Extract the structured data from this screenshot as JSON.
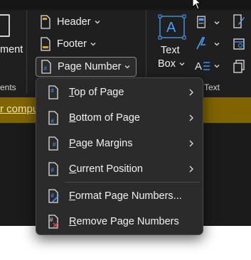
{
  "ribbon": {
    "left_cut_label": "ment",
    "left_group_label": "ents",
    "header_label": "Header",
    "footer_label": "Footer",
    "page_number_label": "Page Number",
    "text_box_line1": "Text",
    "text_box_line2": "Box",
    "text_group_label": "Text"
  },
  "document": {
    "band_text": "r compu"
  },
  "menu": {
    "items": [
      {
        "label": "Top of Page",
        "has_submenu": true,
        "icon": "page-number-top-icon"
      },
      {
        "label": "Bottom of Page",
        "has_submenu": true,
        "icon": "page-number-bottom-icon"
      },
      {
        "label": "Page Margins",
        "has_submenu": true,
        "icon": "page-margins-icon"
      },
      {
        "label": "Current Position",
        "has_submenu": true,
        "icon": "current-position-icon"
      },
      {
        "label": "Format Page Numbers...",
        "has_submenu": false,
        "icon": "format-page-numbers-icon"
      },
      {
        "label": "Remove Page Numbers",
        "has_submenu": false,
        "icon": "remove-page-numbers-icon"
      }
    ]
  },
  "colors": {
    "ribbon_bg": "#1f1f1f",
    "menu_bg": "#2b2b2b",
    "accent_blue": "#4a9eff",
    "doc_band": "#7f6400",
    "remove_red": "#e04040"
  }
}
